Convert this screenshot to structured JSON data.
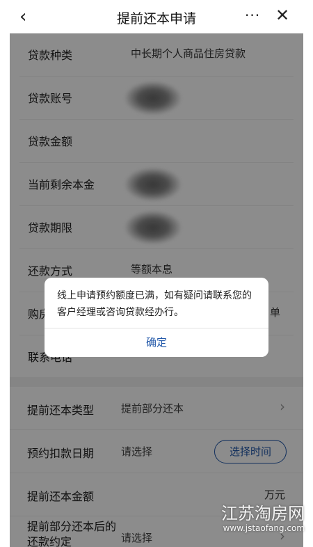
{
  "header": {
    "title": "提前还本申请",
    "back_glyph": "‹",
    "more_glyph": "···",
    "close_glyph": "✕"
  },
  "loan_info": [
    {
      "label": "贷款种类",
      "value": "中长期个人商品住房贷款"
    },
    {
      "label": "贷款账号",
      "value": ""
    },
    {
      "label": "贷款金额",
      "value": ""
    },
    {
      "label": "当前剩余本金",
      "value": ""
    },
    {
      "label": "贷款期限",
      "value": ""
    },
    {
      "label": "还款方式",
      "value": "等额本息"
    },
    {
      "label": "购房",
      "value": "单"
    },
    {
      "label": "联系电话",
      "value": ""
    }
  ],
  "prepayment": {
    "type_label": "提前还本类型",
    "type_value": "提前部分还本",
    "date_label": "预约扣款日期",
    "date_value": "请选择",
    "date_button": "选择时间",
    "amount_label": "提前还本金额",
    "amount_unit": "万元",
    "agreement_label": "提前部分还本后的还款约定",
    "agreement_value": "请选择"
  },
  "dialog": {
    "message": "线上申请预约额度已满，如有疑问请联系您的客户经理或咨询贷款经办行。",
    "confirm": "确定"
  },
  "watermark": {
    "brand": "江苏淘房网",
    "url": "www.jstaofang.com"
  },
  "colors": {
    "accent": "#1e55a8",
    "overlay": "rgba(0,0,0,0.45)"
  }
}
